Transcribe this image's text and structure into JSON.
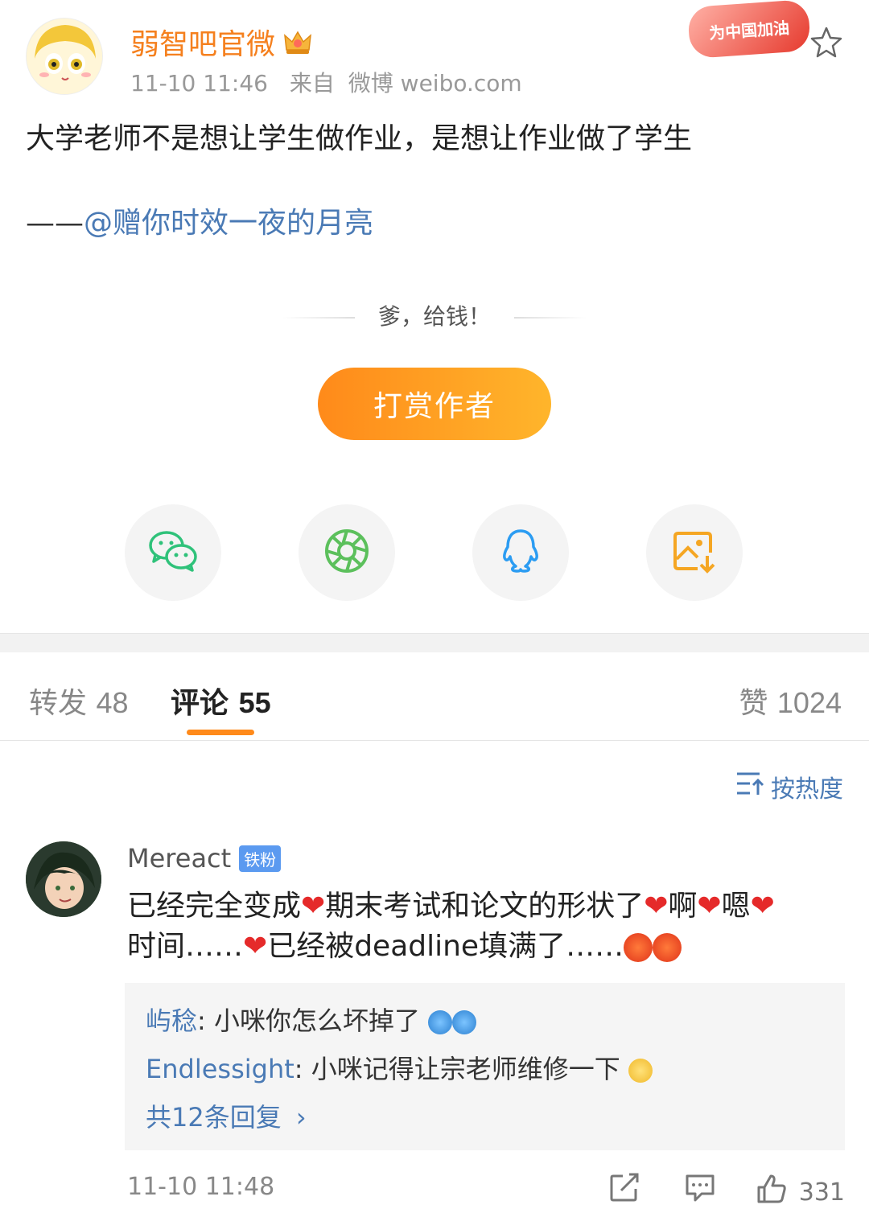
{
  "post": {
    "author": "弱智吧官微",
    "time": "11-10 11:46",
    "source_prefix": "来自",
    "source": "微博 weibo.com",
    "badge": "为中国加油",
    "content": "大学老师不是想让学生做作业，是想让作业做了学生",
    "quote_prefix": "——",
    "quote_mention": "@赠你时效一夜的月亮"
  },
  "reward": {
    "tagline": "爹，给钱！",
    "button": "打赏作者"
  },
  "share": {
    "icons": [
      "wechat-icon",
      "moments-icon",
      "qq-icon",
      "save-image-icon"
    ]
  },
  "tabs": {
    "repost_label": "转发",
    "repost_count": "48",
    "comment_label": "评论",
    "comment_count": "55",
    "like_label": "赞",
    "like_count": "1024"
  },
  "sort": {
    "label": "按热度"
  },
  "comment": {
    "user": "Mereact",
    "fan_badge": "铁粉",
    "line1": "已经完全变成",
    "line1b": "期末考试和论文的形状了",
    "line1c": "啊",
    "line1d": "嗯",
    "line2a": "时间……",
    "line2b": "已经被deadline填满了……",
    "replies": [
      {
        "who": "屿稔",
        "text": ": 小咪你怎么坏掉了"
      },
      {
        "who": "Endlessight",
        "text": ": 小咪记得让宗老师维修一下"
      }
    ],
    "more": "共12条回复",
    "time": "11-10 11:48",
    "likes": "331"
  },
  "colors": {
    "accent": "#ff8a1a",
    "link": "#4a7ab5",
    "author": "#f5801e"
  }
}
